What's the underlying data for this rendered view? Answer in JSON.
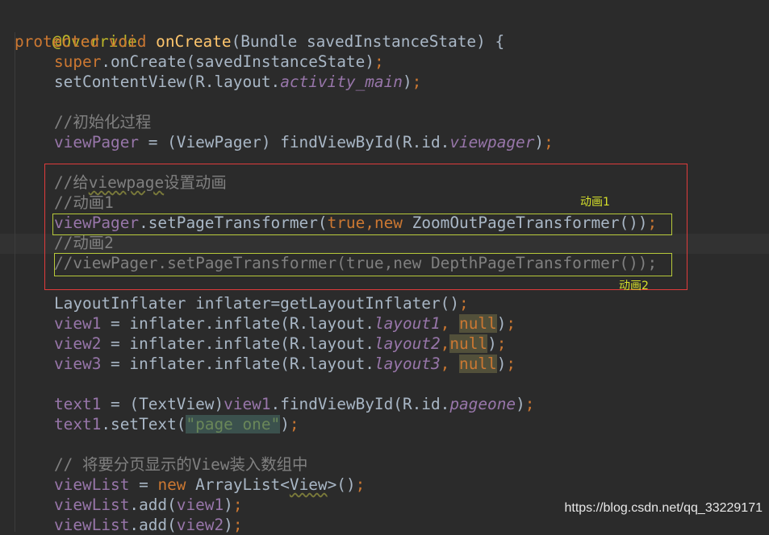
{
  "code": {
    "annotation": "@Override",
    "signature": {
      "kw_protected": "protected",
      "kw_void": "void",
      "method": "onCreate",
      "params": "(Bundle savedInstanceState) {"
    },
    "super_call": {
      "kw": "super",
      "rest": ".onCreate(savedInstanceState)",
      "semi": ";"
    },
    "set_content": {
      "pre": "setContentView(R.layout.",
      "field": "activity_main",
      "post": ")",
      "semi": ";"
    },
    "comment_init": "//初始化过程",
    "find_pager": {
      "var": "viewPager",
      "mid": " = (ViewPager) findViewById(R.id.",
      "field": "viewpager",
      "post": ")",
      "semi": ";"
    },
    "comment_anim": {
      "pre": "//给",
      "squiggle": "viewpage",
      "post": "设置动画"
    },
    "comment_anim1": "//动画1",
    "transformer1": {
      "var": "viewPager",
      "pre": ".setPageTransformer(",
      "kw_true": "true",
      "comma": ",",
      "kw_new": "new",
      "post": " ZoomOutPageTransformer())",
      "semi": ";"
    },
    "comment_anim2": "//动画2",
    "transformer2_comment": "//viewPager.setPageTransformer(true,new DepthPageTransformer());",
    "inflater_line": {
      "pre": "LayoutInflater inflater=getLayoutInflater()",
      "semi": ";"
    },
    "view1": {
      "var": "view1",
      "mid": " = inflater.inflate(R.layout.",
      "field": "layout1",
      "sep": ", ",
      "null": "null",
      "post": ")",
      "semi": ";"
    },
    "view2": {
      "var": "view2",
      "mid": " = inflater.inflate(R.layout.",
      "field": "layout2",
      "sep": ",",
      "null": "null",
      "post": ")",
      "semi": ";"
    },
    "view3": {
      "var": "view3",
      "mid": " = inflater.inflate(R.layout.",
      "field": "layout3",
      "sep": ", ",
      "null": "null",
      "post": ")",
      "semi": ";"
    },
    "text1_find": {
      "var": "text1",
      "mid1": " = (TextView)",
      "var2": "view1",
      "mid2": ".findViewById(R.id.",
      "field": "pageone",
      "post": ")",
      "semi": ";"
    },
    "text1_set": {
      "var": "text1",
      "mid": ".setText(",
      "str": "\"page one\"",
      "post": ")",
      "semi": ";"
    },
    "comment_list": "// 将要分页显示的View装入数组中",
    "viewlist_new": {
      "var": "viewList",
      "eq": " = ",
      "kw_new": "new",
      "mid": " ArrayList<",
      "generic": "View",
      "post": ">()",
      "semi": ";"
    },
    "viewlist_add1": {
      "var": "viewList",
      "mid": ".add(",
      "var2": "view1",
      "post": ")",
      "semi": ";"
    },
    "viewlist_add2": {
      "var": "viewList",
      "mid": ".add(",
      "var2": "view2",
      "post": ")",
      "semi": ";"
    }
  },
  "annotations": {
    "label_anim1": "动画1",
    "label_anim2": "动画2"
  },
  "watermark": "https://blog.csdn.net/qq_33229171",
  "colors": {
    "background": "#2b2b2b",
    "keyword": "#cc7832",
    "method": "#ffc66d",
    "field": "#9876aa",
    "comment": "#808080",
    "string": "#6a8759",
    "red_box": "#e03b3b",
    "yellow_box": "#b7c93a"
  }
}
